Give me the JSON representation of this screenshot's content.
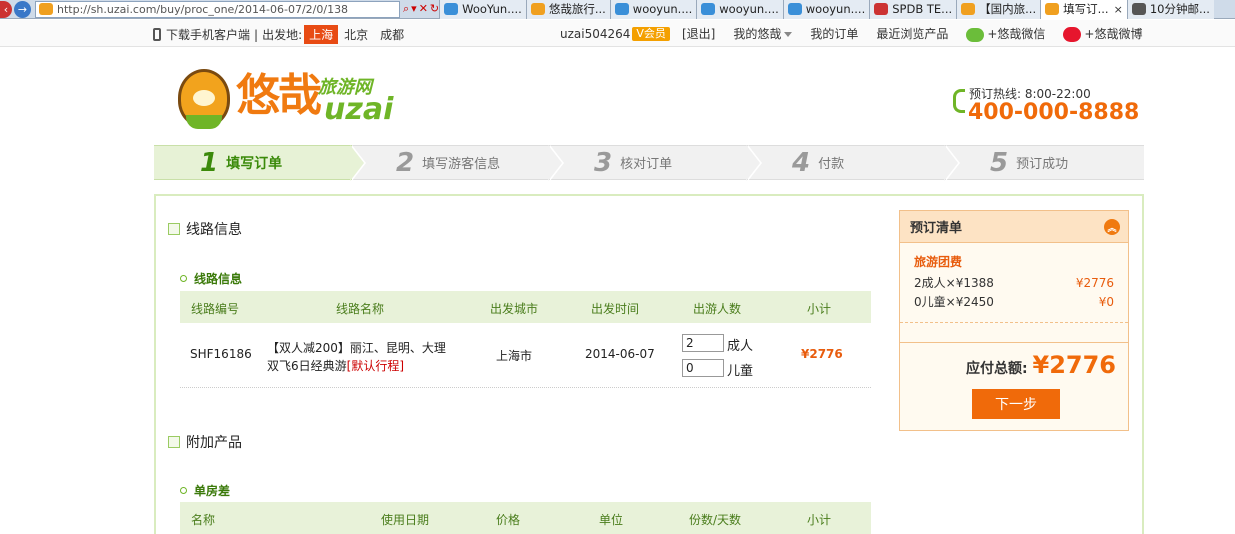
{
  "browser": {
    "url": "http://sh.uzai.com/buy/proc_one/2014-06-07/2/0/138",
    "tabs": [
      {
        "label": "WooYun....",
        "color": "#3a8fd8",
        "active": false
      },
      {
        "label": "悠哉旅行...",
        "color": "#f0a020",
        "active": false
      },
      {
        "label": "wooyun....",
        "color": "#3a8fd8",
        "active": false
      },
      {
        "label": "wooyun....",
        "color": "#3a8fd8",
        "active": false
      },
      {
        "label": "wooyun....",
        "color": "#3a8fd8",
        "active": false
      },
      {
        "label": "SPDB TE...",
        "color": "#c33",
        "active": false
      },
      {
        "label": "【国内旅...",
        "color": "#f0a020",
        "active": false
      },
      {
        "label": "填写订...",
        "color": "#f0a020",
        "active": true
      },
      {
        "label": "10分钟邮...",
        "color": "#555",
        "active": false
      }
    ],
    "close_label": "×"
  },
  "topbar": {
    "download_app": "下载手机客户端",
    "divider": "|",
    "depart_label": "出发地:",
    "city_current": "上海",
    "cities": [
      "北京",
      "成都"
    ],
    "username": "uzai504264",
    "vip_label": "V会员",
    "logout": "[退出]",
    "my_uzai": "我的悠哉",
    "my_orders": "我的订单",
    "recent": "最近浏览产品",
    "wechat": "+悠哉微信",
    "weibo": "+悠哉微博"
  },
  "logo": {
    "cn": "悠哉",
    "sub": "旅游网",
    "en": "uzai"
  },
  "hotline": {
    "label": "预订热线: 8:00-22:00",
    "number": "400-000-8888"
  },
  "steps": [
    {
      "num": "1",
      "label": "填写订单",
      "active": true
    },
    {
      "num": "2",
      "label": "填写游客信息",
      "active": false
    },
    {
      "num": "3",
      "label": "核对订单",
      "active": false
    },
    {
      "num": "4",
      "label": "付款",
      "active": false
    },
    {
      "num": "5",
      "label": "预订成功",
      "active": false
    }
  ],
  "route_section": {
    "title": "线路信息",
    "subtitle": "线路信息",
    "headers": [
      "线路编号",
      "线路名称",
      "出发城市",
      "出发时间",
      "出游人数",
      "小计"
    ],
    "row": {
      "code": "SHF16186",
      "name_line1": "【双人减200】丽江、昆明、大理",
      "name_line2": "双飞6日经典游",
      "itinerary_link": "[默认行程]",
      "city": "上海市",
      "date": "2014-06-07",
      "adults": "2",
      "adult_label": "成人",
      "children": "0",
      "child_label": "儿童",
      "subtotal": "¥2776"
    }
  },
  "extra_section": {
    "title": "附加产品",
    "subtitle": "单房差",
    "headers": [
      "名称",
      "使用日期",
      "价格",
      "单位",
      "份数/天数",
      "小计"
    ]
  },
  "summary": {
    "title": "预订清单",
    "group": "旅游团费",
    "lines": [
      {
        "label": "2成人×¥1388",
        "price": "¥2776"
      },
      {
        "label": "0儿童×¥2450",
        "price": "¥0"
      }
    ],
    "total_label": "应付总额:",
    "total_amount": "¥2776",
    "next_button": "下一步"
  }
}
